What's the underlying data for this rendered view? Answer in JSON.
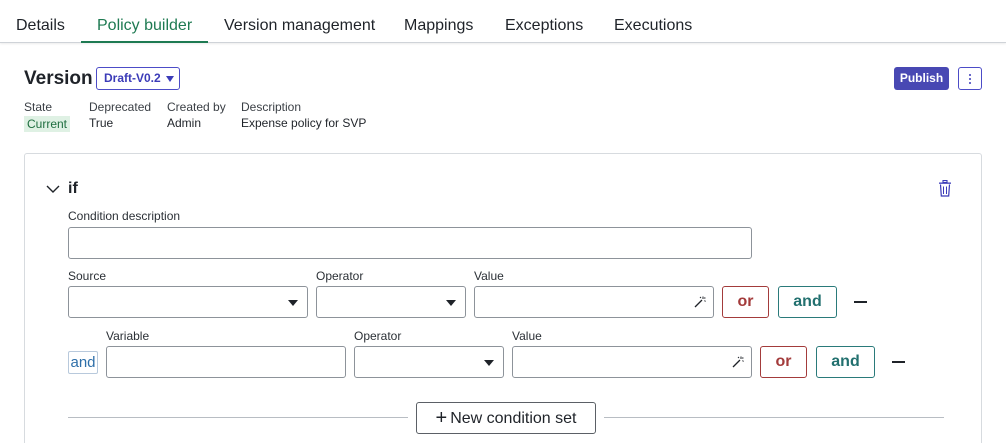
{
  "tabs": [
    {
      "label": "Details"
    },
    {
      "label": "Policy builder",
      "active": true
    },
    {
      "label": "Version management"
    },
    {
      "label": "Mappings"
    },
    {
      "label": "Exceptions"
    },
    {
      "label": "Executions"
    }
  ],
  "version": {
    "title": "Version",
    "selected": "Draft-V0.2",
    "publish_label": "Publish"
  },
  "meta": {
    "state": {
      "label": "State",
      "value": "Current"
    },
    "deprecated": {
      "label": "Deprecated",
      "value": "True"
    },
    "created_by": {
      "label": "Created by",
      "value": "Admin"
    },
    "description": {
      "label": "Description",
      "value": "Expense policy for SVP"
    }
  },
  "condition": {
    "keyword": "if",
    "description_label": "Condition description",
    "description_value": "",
    "row1": {
      "source_label": "Source",
      "operator_label": "Operator",
      "value_label": "Value",
      "or_label": "or",
      "and_label": "and"
    },
    "row2": {
      "connector": "and",
      "variable_label": "Variable",
      "operator_label": "Operator",
      "value_label": "Value",
      "or_label": "or",
      "and_label": "and"
    },
    "new_condition_set_label": "New condition set"
  },
  "colors": {
    "accent_green": "#1e7a52",
    "primary": "#4848b3",
    "or_red": "#a33b3b",
    "and_teal": "#22706f"
  }
}
